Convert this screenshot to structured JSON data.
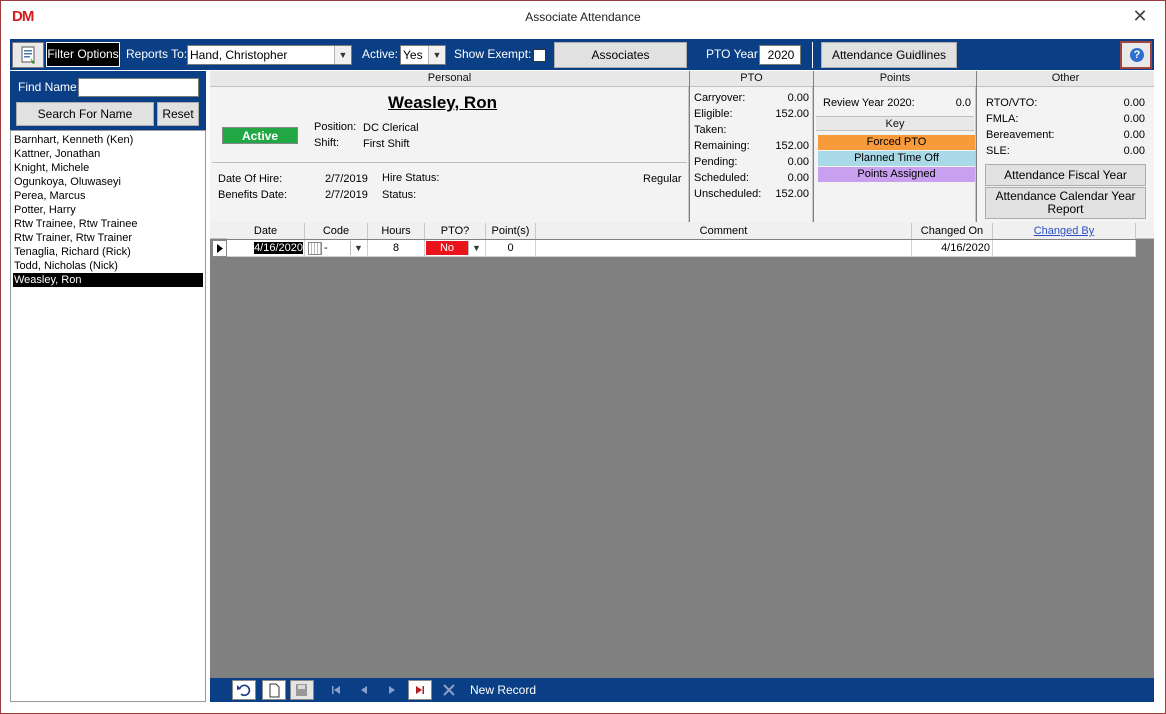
{
  "window": {
    "logo": "DM",
    "title": "Associate Attendance",
    "close_glyph": "✕"
  },
  "toolbar": {
    "filter_options": "Filter Options",
    "reports_to_label": "Reports To:",
    "reports_to_value": "Hand, Christopher",
    "active_label": "Active:",
    "active_value": "Yes",
    "show_exempt_label": "Show Exempt:",
    "associates_button": "Associates",
    "pto_year_label": "PTO Year:",
    "pto_year_value": "2020",
    "attendance_guidelines_button": "Attendance Guidlines",
    "help_glyph": "?"
  },
  "sidebar": {
    "find_name_label": "Find Name:",
    "find_name_value": "",
    "search_button": "Search For Name",
    "reset_button": "Reset",
    "associates": [
      "Barnhart, Kenneth (Ken)",
      "Kattner, Jonathan",
      "Knight, Michele",
      "Ogunkoya, Oluwaseyi",
      "Perea, Marcus",
      "Potter, Harry",
      "Rtw Trainee, Rtw Trainee",
      "Rtw Trainer, Rtw Trainer",
      "Tenaglia, Richard (Rick)",
      "Todd, Nicholas (Nick)",
      "Weasley, Ron"
    ],
    "selected_index": 10
  },
  "personal": {
    "header": "Personal",
    "name": "Weasley, Ron",
    "status_badge": "Active",
    "position_label": "Position:",
    "position_value": "DC Clerical",
    "shift_label": "Shift:",
    "shift_value": "First Shift",
    "date_of_hire_label": "Date Of Hire:",
    "date_of_hire_value": "2/7/2019",
    "hire_status_label": "Hire Status:",
    "hire_status_value": "Regular",
    "benefits_date_label": "Benefits Date:",
    "benefits_date_value": "2/7/2019",
    "status_label": "Status:",
    "status_value": ""
  },
  "pto": {
    "header": "PTO",
    "rows": [
      {
        "label": "Carryover:",
        "value": "0.00"
      },
      {
        "label": "Eligible:",
        "value": "152.00"
      },
      {
        "label": "Taken:",
        "value": ""
      },
      {
        "label": "Remaining:",
        "value": "152.00"
      },
      {
        "label": "Pending:",
        "value": "0.00"
      },
      {
        "label": "Scheduled:",
        "value": "0.00"
      },
      {
        "label": "Unscheduled:",
        "value": "152.00"
      }
    ]
  },
  "points": {
    "header": "Points",
    "review_label": "Review Year 2020:",
    "review_value": "0.0",
    "key_header": "Key",
    "key_items": [
      {
        "label": "Forced PTO",
        "color": "#f79a3a"
      },
      {
        "label": "Planned Time Off",
        "color": "#a9d8e6"
      },
      {
        "label": "Points Assigned",
        "color": "#c9a0f0"
      }
    ]
  },
  "other": {
    "header": "Other",
    "rows": [
      {
        "label": "RTO/VTO:",
        "value": "0.00"
      },
      {
        "label": "FMLA:",
        "value": "0.00"
      },
      {
        "label": "Bereavement:",
        "value": "0.00"
      },
      {
        "label": "SLE:",
        "value": "0.00"
      }
    ],
    "fiscal_report_button": "Attendance Fiscal Year Report",
    "calendar_report_button": "Attendance Calendar Year Report"
  },
  "grid": {
    "columns": [
      "Date",
      "Code",
      "Hours",
      "PTO?",
      "Point(s)",
      "Comment",
      "Changed On",
      "Changed By"
    ],
    "row": {
      "date": "4/16/2020",
      "code": "-",
      "hours": "8",
      "pto": "No",
      "points": "0",
      "comment": "",
      "changed_on": "4/16/2020",
      "changed_by": ""
    }
  },
  "nav": {
    "new_record_label": "New Record"
  },
  "colors": {
    "toolbar_blue": "#0a3f86",
    "active_green": "#21a845",
    "pto_no_red": "#e8141a",
    "selection_black": "#000000"
  }
}
